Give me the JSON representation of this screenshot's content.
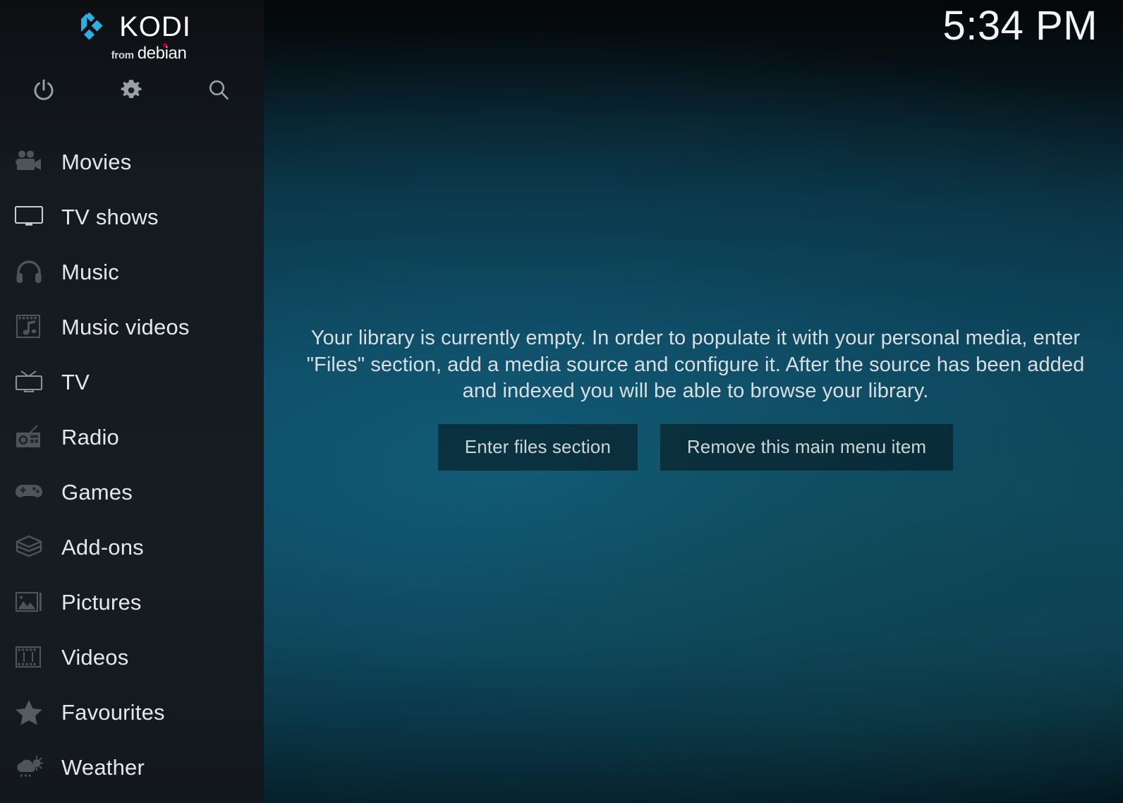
{
  "app": {
    "logo_word": "KODI",
    "logo_from": "from",
    "logo_distro": "debian",
    "logo_accent_color": "#2eafe3",
    "debian_swirl_color": "#a80030"
  },
  "header": {
    "clock": "5:34 PM"
  },
  "toolbar": {
    "items": [
      {
        "name": "power",
        "icon": "power-icon",
        "label": "Power"
      },
      {
        "name": "settings",
        "icon": "gear-icon",
        "label": "Settings"
      },
      {
        "name": "search",
        "icon": "search-icon",
        "label": "Search"
      }
    ]
  },
  "sidebar": {
    "items": [
      {
        "label": "Movies",
        "icon": "movie-camera-icon"
      },
      {
        "label": "TV shows",
        "icon": "television-icon"
      },
      {
        "label": "Music",
        "icon": "headphones-icon"
      },
      {
        "label": "Music videos",
        "icon": "music-film-icon"
      },
      {
        "label": "TV",
        "icon": "retro-tv-icon"
      },
      {
        "label": "Radio",
        "icon": "radio-icon"
      },
      {
        "label": "Games",
        "icon": "gamepad-icon"
      },
      {
        "label": "Add-ons",
        "icon": "open-box-icon"
      },
      {
        "label": "Pictures",
        "icon": "photo-icon"
      },
      {
        "label": "Videos",
        "icon": "film-strip-icon"
      },
      {
        "label": "Favourites",
        "icon": "star-icon"
      },
      {
        "label": "Weather",
        "icon": "cloud-sun-rain-icon"
      }
    ]
  },
  "main": {
    "empty_message": "Your library is currently empty. In order to populate it with your personal media, enter \"Files\" section, add a media source and configure it. After the source has been added and indexed you will be able to browse your library.",
    "buttons": {
      "enter_files": "Enter files section",
      "remove_menu_item": "Remove this main menu item"
    }
  },
  "colors": {
    "sidebar_bg": "#161c22",
    "main_teal": "#0e4860",
    "text_primary": "#e4e8ea",
    "text_body": "#d9dee1",
    "icon_gray": "#4a5056",
    "icon_gray_light": "#9aa1a6"
  }
}
